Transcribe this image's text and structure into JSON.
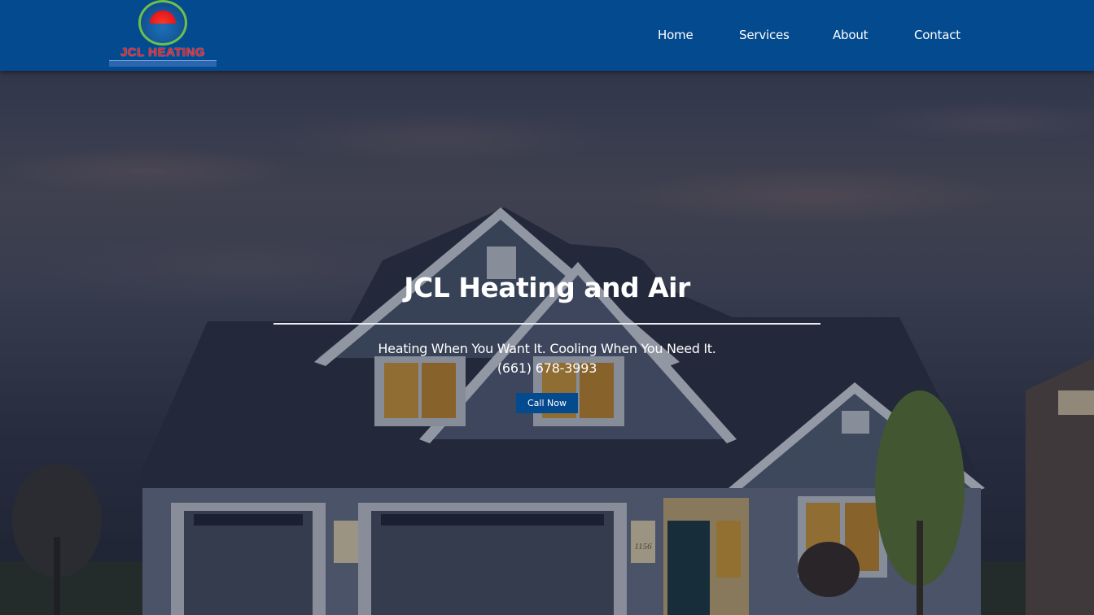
{
  "header": {
    "logo_text": "JCL HEATING",
    "nav": [
      {
        "label": "Home"
      },
      {
        "label": "Services"
      },
      {
        "label": "About"
      },
      {
        "label": "Contact"
      }
    ]
  },
  "hero": {
    "title": "JCL Heating and Air",
    "tagline": "Heating When You Want It. Cooling When You Need It.",
    "phone": "(661) 678-3993",
    "cta_label": "Call Now",
    "house_number": "1156"
  },
  "colors": {
    "header_bg": "#044a8f",
    "button_bg": "#044a8f",
    "text": "#ffffff",
    "logo_red": "#e8242a",
    "logo_green": "#6cc04a"
  }
}
